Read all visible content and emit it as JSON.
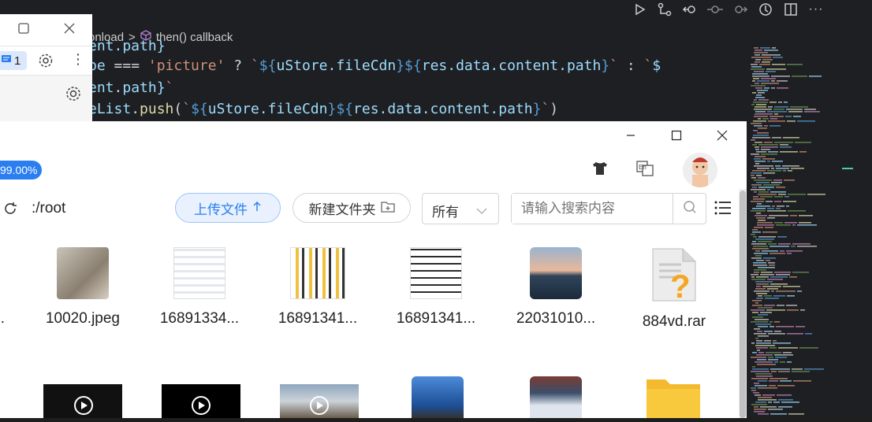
{
  "editor": {
    "breadcrumb": {
      "prev": "onload",
      "separator": ">",
      "current": "then() callback"
    },
    "lines": [
      {
        "text": "ent.path}"
      },
      {
        "text": "pe === 'picture' ? `${uStore.fileCdn}${res.data.content.path}` : `$"
      },
      {
        "text": "ent.path}`"
      },
      {
        "text": "eList.push(`${uStore.fileCdn}${res.data.content.path}`)"
      }
    ],
    "toolbar_icons": [
      "run-icon",
      "source-control-graph-icon",
      "go-back-icon",
      "go-commit-icon",
      "go-forward-icon",
      "timeline-icon",
      "split-editor-icon",
      "more-icon"
    ]
  },
  "small_window": {
    "badge_count": "1"
  },
  "file_manager": {
    "usage_badge": "99.00%",
    "path": ":/root",
    "upload_label": "上传文件",
    "newfolder_label": "新建文件夹",
    "filter_value": "所有",
    "search_placeholder": "请输入搜索内容",
    "files_row1": [
      {
        "name": "..."
      },
      {
        "name": "10020.jpeg"
      },
      {
        "name": "16891334..."
      },
      {
        "name": "16891341..."
      },
      {
        "name": "16891341..."
      },
      {
        "name": "22031010..."
      },
      {
        "name": "884vd.rar"
      }
    ]
  },
  "colors": {
    "accent": "#2a7ef0",
    "editor_bg": "#1e1f22"
  }
}
